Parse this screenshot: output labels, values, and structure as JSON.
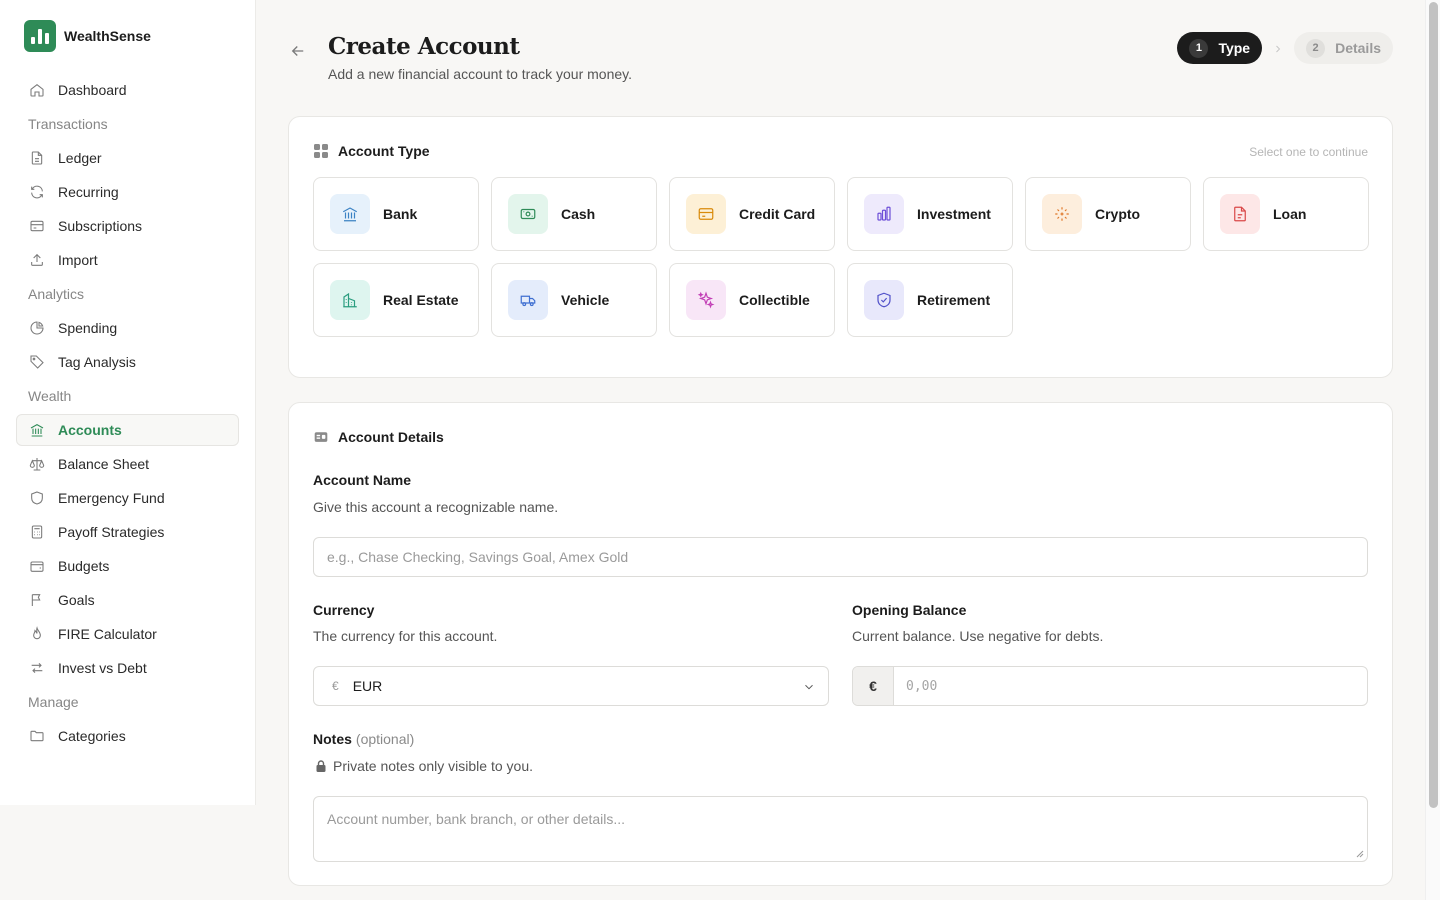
{
  "app": {
    "name": "WealthSense"
  },
  "sidebar": {
    "items": [
      {
        "kind": "item",
        "label": "Dashboard",
        "icon": "home-icon"
      },
      {
        "kind": "section",
        "label": "Transactions"
      },
      {
        "kind": "item",
        "label": "Ledger",
        "icon": "document-icon"
      },
      {
        "kind": "item",
        "label": "Recurring",
        "icon": "refresh-icon"
      },
      {
        "kind": "item",
        "label": "Subscriptions",
        "icon": "credit-card-icon"
      },
      {
        "kind": "item",
        "label": "Import",
        "icon": "upload-icon"
      },
      {
        "kind": "section",
        "label": "Analytics"
      },
      {
        "kind": "item",
        "label": "Spending",
        "icon": "pie-chart-icon"
      },
      {
        "kind": "item",
        "label": "Tag Analysis",
        "icon": "tag-icon"
      },
      {
        "kind": "section",
        "label": "Wealth"
      },
      {
        "kind": "item",
        "label": "Accounts",
        "icon": "bank-icon",
        "active": true
      },
      {
        "kind": "item",
        "label": "Balance Sheet",
        "icon": "scale-icon"
      },
      {
        "kind": "item",
        "label": "Emergency Fund",
        "icon": "shield-icon"
      },
      {
        "kind": "item",
        "label": "Payoff Strategies",
        "icon": "calculator-icon"
      },
      {
        "kind": "item",
        "label": "Budgets",
        "icon": "wallet-icon"
      },
      {
        "kind": "item",
        "label": "Goals",
        "icon": "flag-icon"
      },
      {
        "kind": "item",
        "label": "FIRE Calculator",
        "icon": "flame-icon"
      },
      {
        "kind": "item",
        "label": "Invest vs Debt",
        "icon": "arrows-swap-icon"
      },
      {
        "kind": "section",
        "label": "Manage"
      },
      {
        "kind": "item",
        "label": "Categories",
        "icon": "folder-icon"
      }
    ]
  },
  "header": {
    "title": "Create Account",
    "subtitle": "Add a new financial account to track your money.",
    "steps": [
      {
        "num": "1",
        "label": "Type",
        "active": true
      },
      {
        "num": "2",
        "label": "Details",
        "active": false
      }
    ]
  },
  "account_type": {
    "heading": "Account Type",
    "hint": "Select one to continue",
    "types": [
      {
        "label": "Bank",
        "icon": "bank-icon",
        "bg": "#e6f1fb",
        "color": "#3b82c4"
      },
      {
        "label": "Cash",
        "icon": "banknote-icon",
        "bg": "#e3f5ec",
        "color": "#2e8b57"
      },
      {
        "label": "Credit Card",
        "icon": "credit-card-icon",
        "bg": "#fdf0d6",
        "color": "#d98a0b"
      },
      {
        "label": "Investment",
        "icon": "bar-chart-icon",
        "bg": "#eeeafc",
        "color": "#6d4fd8"
      },
      {
        "label": "Crypto",
        "icon": "crypto-icon",
        "bg": "#fdeedd",
        "color": "#e0782a"
      },
      {
        "label": "Loan",
        "icon": "file-icon",
        "bg": "#fde7e7",
        "color": "#d94848"
      },
      {
        "label": "Real Estate",
        "icon": "building-icon",
        "bg": "#def5ef",
        "color": "#2a9d7f"
      },
      {
        "label": "Vehicle",
        "icon": "truck-icon",
        "bg": "#e4ecfb",
        "color": "#3f6fd1"
      },
      {
        "label": "Collectible",
        "icon": "sparkles-icon",
        "bg": "#f8e6f7",
        "color": "#c23fb6"
      },
      {
        "label": "Retirement",
        "icon": "shield-check-icon",
        "bg": "#e8e8fb",
        "color": "#5151c9"
      }
    ]
  },
  "details": {
    "heading": "Account Details",
    "name": {
      "label": "Account Name",
      "help": "Give this account a recognizable name.",
      "placeholder": "e.g., Chase Checking, Savings Goal, Amex Gold"
    },
    "currency": {
      "label": "Currency",
      "help": "The currency for this account.",
      "symbol": "€",
      "value": "EUR"
    },
    "balance": {
      "label": "Opening Balance",
      "help": "Current balance. Use negative for debts.",
      "prefix": "€",
      "placeholder": "0,00"
    },
    "notes": {
      "label": "Notes",
      "optional": "(optional)",
      "help": "Private notes only visible to you.",
      "placeholder": "Account number, bank branch, or other details..."
    }
  }
}
